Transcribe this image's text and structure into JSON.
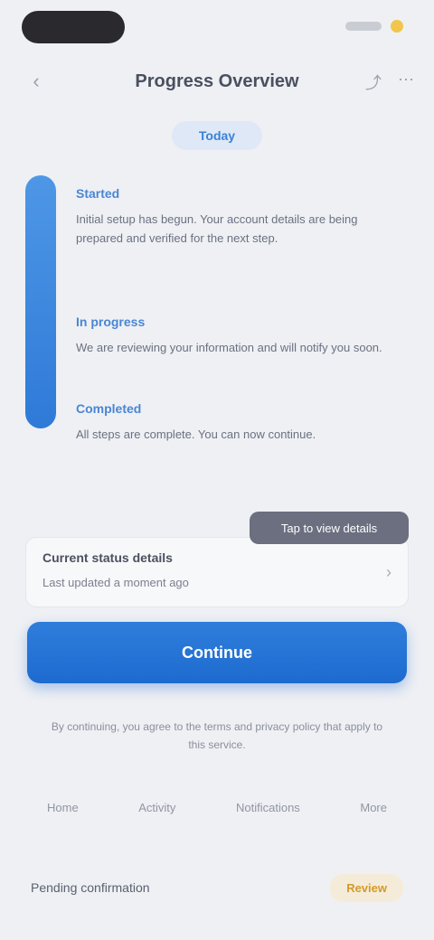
{
  "status": {
    "left": "",
    "right": ""
  },
  "header": {
    "title": "Progress Overview",
    "back_glyph": "‹",
    "action1": "⤴",
    "action2": "⋯"
  },
  "tag": {
    "label": "Today"
  },
  "timeline": {
    "items": [
      {
        "title": "Started",
        "text": "Initial setup has begun. Your account details are being prepared and verified for the next step."
      },
      {
        "title": "In progress",
        "text": "We are reviewing your information and will notify you soon."
      },
      {
        "title": "Completed",
        "text": "All steps are complete. You can now continue."
      }
    ]
  },
  "tooltip": {
    "label": "Tap to view details"
  },
  "card": {
    "title": "Current status details",
    "subtitle": "Last updated a moment ago",
    "chevron": "›"
  },
  "cta": {
    "label": "Continue"
  },
  "note": {
    "text": "By continuing, you agree to the terms and privacy policy that apply to this service."
  },
  "tabs": [
    "Home",
    "Activity",
    "Notifications",
    "More"
  ],
  "bottom": {
    "label": "Pending confirmation",
    "badge": "Review"
  }
}
